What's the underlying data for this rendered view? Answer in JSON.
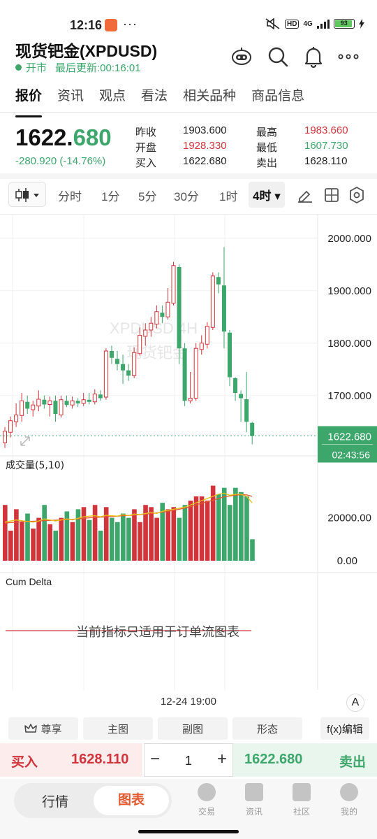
{
  "status": {
    "time": "12:16",
    "dots": "···",
    "hd": "HD",
    "network": "4G",
    "battery": "93"
  },
  "header": {
    "title": "现货钯金(XPDUSD)",
    "market_state": "开市",
    "last_update": "最后更新:00:16:01"
  },
  "tabs": [
    "报价",
    "资讯",
    "观点",
    "看法",
    "相关品种",
    "商品信息"
  ],
  "quote": {
    "price_int": "1622.",
    "price_dec": "680",
    "change": "-280.920 (-14.76%)",
    "prev_close_label": "昨收",
    "prev_close": "1903.600",
    "open_label": "开盘",
    "open": "1928.330",
    "buy_label": "买入",
    "buy": "1622.680",
    "high_label": "最高",
    "high": "1983.660",
    "low_label": "最低",
    "low": "1607.730",
    "sell_label": "卖出",
    "sell": "1628.110"
  },
  "toolbar": {
    "periods": [
      "分时",
      "1分",
      "5分",
      "30分",
      "1时",
      "4时"
    ],
    "active_period": "4时"
  },
  "chart_data": {
    "type": "candlestick",
    "watermark": {
      "line1": "XPDUSD 4H",
      "line2": "现货钯金"
    },
    "price_axis": {
      "ticks": [
        "2000.000",
        "1900.000",
        "1800.000",
        "1700.000"
      ],
      "ylim": [
        1585,
        2045
      ]
    },
    "current_price_label": "1622.680",
    "countdown": "02:43:56",
    "candles": [
      {
        "o": 1610,
        "h": 1640,
        "l": 1600,
        "c": 1632
      },
      {
        "o": 1630,
        "h": 1660,
        "l": 1620,
        "c": 1652
      },
      {
        "o": 1650,
        "h": 1685,
        "l": 1640,
        "c": 1663
      },
      {
        "o": 1662,
        "h": 1705,
        "l": 1650,
        "c": 1690
      },
      {
        "o": 1688,
        "h": 1700,
        "l": 1665,
        "c": 1675
      },
      {
        "o": 1673,
        "h": 1690,
        "l": 1660,
        "c": 1682
      },
      {
        "o": 1680,
        "h": 1710,
        "l": 1670,
        "c": 1693
      },
      {
        "o": 1692,
        "h": 1700,
        "l": 1675,
        "c": 1683
      },
      {
        "o": 1683,
        "h": 1698,
        "l": 1660,
        "c": 1690
      },
      {
        "o": 1690,
        "h": 1700,
        "l": 1650,
        "c": 1665
      },
      {
        "o": 1663,
        "h": 1700,
        "l": 1658,
        "c": 1692
      },
      {
        "o": 1690,
        "h": 1700,
        "l": 1678,
        "c": 1682
      },
      {
        "o": 1682,
        "h": 1698,
        "l": 1675,
        "c": 1690
      },
      {
        "o": 1690,
        "h": 1695,
        "l": 1678,
        "c": 1685
      },
      {
        "o": 1685,
        "h": 1705,
        "l": 1680,
        "c": 1692
      },
      {
        "o": 1692,
        "h": 1705,
        "l": 1683,
        "c": 1688
      },
      {
        "o": 1688,
        "h": 1712,
        "l": 1683,
        "c": 1703
      },
      {
        "o": 1702,
        "h": 1710,
        "l": 1690,
        "c": 1695
      },
      {
        "o": 1697,
        "h": 1790,
        "l": 1692,
        "c": 1785
      },
      {
        "o": 1785,
        "h": 1795,
        "l": 1760,
        "c": 1772
      },
      {
        "o": 1770,
        "h": 1785,
        "l": 1748,
        "c": 1760
      },
      {
        "o": 1760,
        "h": 1778,
        "l": 1722,
        "c": 1748
      },
      {
        "o": 1748,
        "h": 1760,
        "l": 1728,
        "c": 1738
      },
      {
        "o": 1738,
        "h": 1792,
        "l": 1733,
        "c": 1782
      },
      {
        "o": 1780,
        "h": 1830,
        "l": 1776,
        "c": 1815
      },
      {
        "o": 1813,
        "h": 1838,
        "l": 1795,
        "c": 1825
      },
      {
        "o": 1825,
        "h": 1850,
        "l": 1812,
        "c": 1838
      },
      {
        "o": 1836,
        "h": 1872,
        "l": 1828,
        "c": 1860
      },
      {
        "o": 1858,
        "h": 1872,
        "l": 1838,
        "c": 1850
      },
      {
        "o": 1850,
        "h": 1905,
        "l": 1845,
        "c": 1878
      },
      {
        "o": 1876,
        "h": 1955,
        "l": 1872,
        "c": 1948
      },
      {
        "o": 1945,
        "h": 1950,
        "l": 1760,
        "c": 1790
      },
      {
        "o": 1790,
        "h": 1800,
        "l": 1680,
        "c": 1690
      },
      {
        "o": 1690,
        "h": 1745,
        "l": 1685,
        "c": 1695
      },
      {
        "o": 1695,
        "h": 1800,
        "l": 1690,
        "c": 1790
      },
      {
        "o": 1788,
        "h": 1815,
        "l": 1778,
        "c": 1800
      },
      {
        "o": 1798,
        "h": 1840,
        "l": 1790,
        "c": 1832
      },
      {
        "o": 1830,
        "h": 1935,
        "l": 1825,
        "c": 1928
      },
      {
        "o": 1926,
        "h": 1935,
        "l": 1895,
        "c": 1912
      },
      {
        "o": 1910,
        "h": 1983,
        "l": 1790,
        "c": 1822
      },
      {
        "o": 1820,
        "h": 1825,
        "l": 1718,
        "c": 1735
      },
      {
        "o": 1733,
        "h": 1735,
        "l": 1690,
        "c": 1705
      },
      {
        "o": 1703,
        "h": 1710,
        "l": 1650,
        "c": 1695
      },
      {
        "o": 1693,
        "h": 1745,
        "l": 1630,
        "c": 1650
      },
      {
        "o": 1648,
        "h": 1650,
        "l": 1607,
        "c": 1623
      }
    ],
    "volume": {
      "label": "成交量(5,10)",
      "ticks": [
        "20000.00",
        "0.00"
      ],
      "ymax": 44000,
      "values": [
        26000,
        14000,
        24000,
        18000,
        22000,
        15000,
        20000,
        26000,
        17000,
        14000,
        20000,
        23000,
        18000,
        24000,
        25000,
        19000,
        26000,
        14000,
        25000,
        20000,
        18000,
        22000,
        20000,
        24000,
        18000,
        26000,
        25000,
        20000,
        27000,
        24000,
        25000,
        20000,
        26000,
        28000,
        30000,
        30000,
        28000,
        35000,
        31000,
        34000,
        26000,
        34000,
        32000,
        30000,
        10000
      ],
      "ma5": [
        18000,
        18500,
        19000,
        18700,
        18300,
        18000,
        18500,
        19500,
        19000,
        18500,
        19000,
        19500,
        19000,
        19800,
        20500,
        20800,
        21000,
        20500,
        21200,
        21000,
        20800,
        21500,
        21000,
        21800,
        21500,
        22000,
        22500,
        22000,
        23000,
        23500,
        24000,
        24500,
        25000,
        26000,
        27000,
        28000,
        29000,
        30000,
        31000,
        31500,
        30500,
        31000,
        31000,
        30000,
        27000
      ],
      "ma10": [
        17500,
        17800,
        18000,
        18200,
        18300,
        18400,
        18500,
        18700,
        18800,
        18900,
        19000,
        19200,
        19300,
        19500,
        19800,
        20000,
        20200,
        20300,
        20500,
        20600,
        20800,
        21000,
        21100,
        21300,
        21500,
        21700,
        22000,
        22300,
        22600,
        23000,
        23500,
        24000,
        24500,
        25200,
        26000,
        26800,
        27500,
        28200,
        29000,
        29800,
        30200,
        30500,
        30800,
        30700,
        30000
      ]
    },
    "cum_delta": {
      "label": "Cum Delta",
      "message": "当前指标只适用于订单流图表"
    }
  },
  "bottom": {
    "time_label": "12-24 19:00",
    "font_toggle": "A",
    "controls": [
      "尊享",
      "主图",
      "副图",
      "形态",
      "f(x)编辑"
    ]
  },
  "trade": {
    "buy_label": "买入",
    "buy_price": "1628.110",
    "qty": "1",
    "sell_price": "1622.680",
    "sell_label": "卖出"
  },
  "nav": {
    "seg_left": "行情",
    "seg_right": "图表",
    "items": [
      "交易",
      "资讯",
      "社区",
      "我的"
    ]
  },
  "colors": {
    "up": "#d2343b",
    "down": "#3da66b",
    "accent": "#e25a2f"
  }
}
